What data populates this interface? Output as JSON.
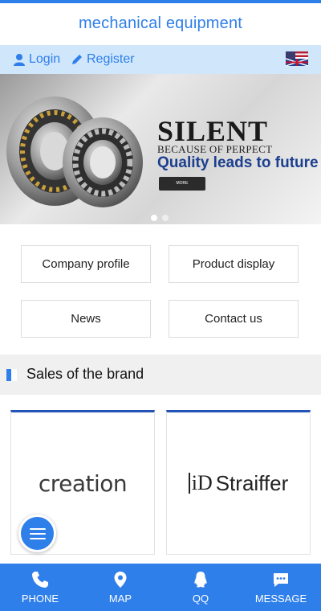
{
  "header": {
    "title": "mechanical equipment"
  },
  "userbar": {
    "login": {
      "label": "Login",
      "icon": "user-icon"
    },
    "register": {
      "label": "Register",
      "icon": "pencil-icon"
    },
    "language_icon": "flag-icon"
  },
  "banner": {
    "headline": "SILENT",
    "subline": "BECAUSE OF PERPECT",
    "slogan": "Quality leads to future",
    "button": "MORE",
    "slides_total": 2,
    "active_slide": 1
  },
  "nav": {
    "items": [
      {
        "label": "Company profile"
      },
      {
        "label": "Product display"
      },
      {
        "label": "News"
      },
      {
        "label": "Contact us"
      }
    ]
  },
  "section": {
    "title": "Sales of the brand"
  },
  "brands": [
    {
      "name": "creation"
    },
    {
      "mark": "iD",
      "name": "Straiffer"
    }
  ],
  "bottom_nav": [
    {
      "label": "PHONE",
      "icon": "phone-icon"
    },
    {
      "label": "MAP",
      "icon": "map-pin-icon"
    },
    {
      "label": "QQ",
      "icon": "qq-icon"
    },
    {
      "label": "MESSAGE",
      "icon": "message-icon"
    }
  ],
  "colors": {
    "primary": "#2f7fea",
    "userbar_bg": "#cfe6fb",
    "brand_border": "#2453b8"
  }
}
